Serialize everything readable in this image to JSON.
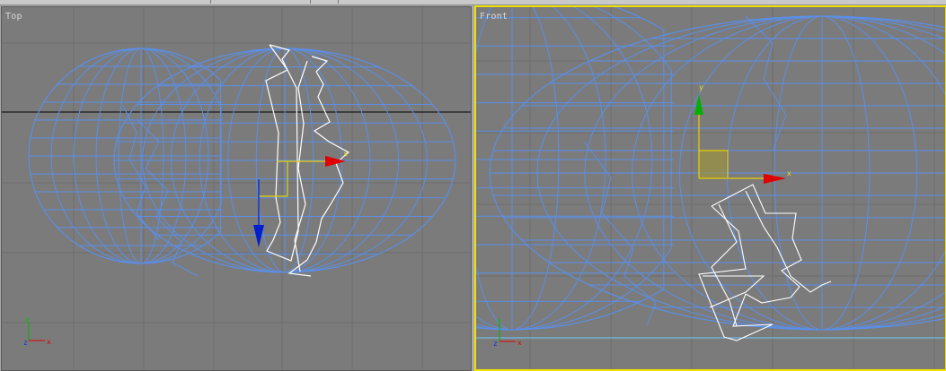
{
  "viewports": [
    {
      "id": "top",
      "label": "Top",
      "active": false
    },
    {
      "id": "front",
      "label": "Front",
      "active": true
    }
  ],
  "gizmo_top": {
    "x_axis": "x",
    "y_axis": "y",
    "z_axis": "z"
  },
  "gizmo_front": {
    "x_axis": "x",
    "y_axis": "y"
  },
  "corner_axes_top": {
    "x": "x",
    "y": "y",
    "z": "z"
  },
  "corner_axes_front": {
    "x": "x",
    "y": "y",
    "z": "z"
  },
  "colors": {
    "viewport_bg": "#7b7b7b",
    "wireframe": "#5b8fe8",
    "selection": "#ffffff",
    "active_border": "#f0e000",
    "axis_x": "#e00000",
    "axis_y": "#00b000",
    "axis_z": "#0020d0",
    "gizmo_plane": "#e8d000"
  }
}
